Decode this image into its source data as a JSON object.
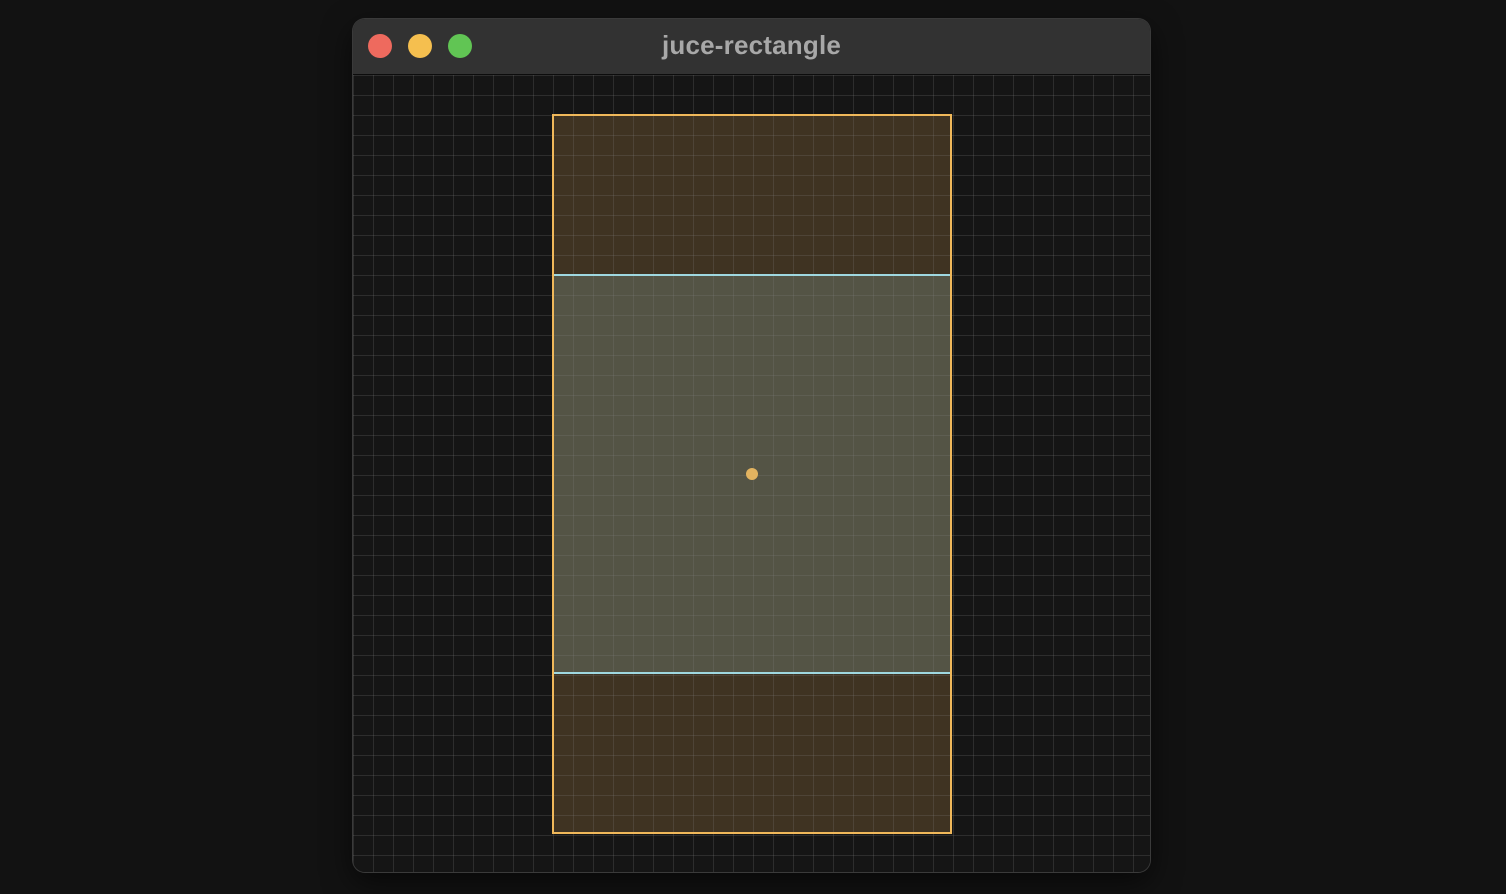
{
  "window": {
    "title": "juce-rectangle",
    "buttons": {
      "close_color": "#ee6a5e",
      "minimize_color": "#f5bf4f",
      "zoom_color": "#61c554"
    }
  },
  "canvas": {
    "background": "#151515",
    "grid_color": "#2c2c2c",
    "outer_rect_stroke": "#f0b85a",
    "outer_rect_fill": "#3f3322",
    "inner_rect_stroke": "#9fd8e0",
    "inner_rect_fill": "#545445",
    "center_point_color": "#e2b360"
  }
}
